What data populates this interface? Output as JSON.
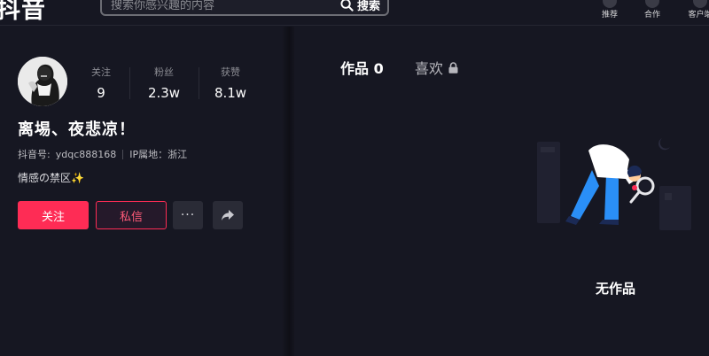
{
  "header": {
    "logo": "抖音",
    "search": {
      "placeholder": "搜索你感兴趣的内容",
      "button_label": "搜索"
    },
    "nav": [
      {
        "label": "推荐",
        "icon": "recommend-icon"
      },
      {
        "label": "合作",
        "icon": "cooperation-icon"
      },
      {
        "label": "客户端",
        "icon": "client-icon"
      }
    ]
  },
  "profile": {
    "stats": [
      {
        "label": "关注",
        "value": "9"
      },
      {
        "label": "粉丝",
        "value": "2.3w"
      },
      {
        "label": "获赞",
        "value": "8.1w"
      }
    ],
    "nickname": "离埸、夜悲凉！",
    "douyin_id_label": "抖音号:",
    "douyin_id": "ydqc888168",
    "ip_location": "IP属地：浙江",
    "signature": "情感の禁区✨",
    "buttons": {
      "follow": "关注",
      "message": "私信",
      "more": "···"
    }
  },
  "works": {
    "tabs": [
      {
        "label": "作品 0",
        "active": true
      },
      {
        "label": "喜欢",
        "locked": true
      }
    ],
    "empty_text": "无作品"
  },
  "colors": {
    "background": "#161722",
    "accent": "#fe2c55",
    "illustration_blue": "#2a8ff7"
  }
}
